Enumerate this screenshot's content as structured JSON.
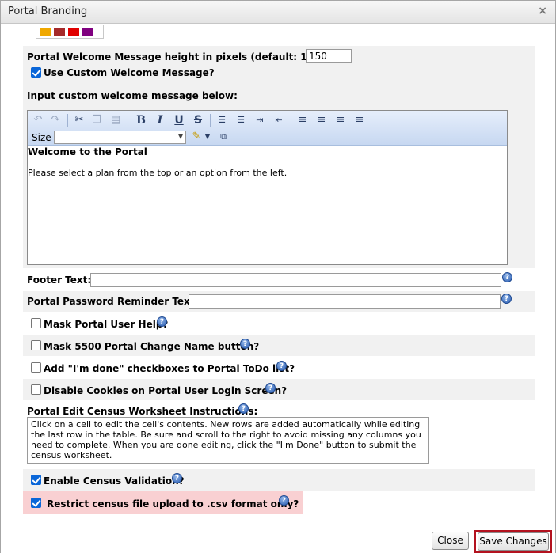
{
  "dialog": {
    "title": "Portal Branding",
    "close_glyph": "×"
  },
  "swatch_colors": [
    "#f0a800",
    "#a52a2a",
    "#e00000",
    "#800080"
  ],
  "welcome_height": {
    "label": "Portal Welcome Message height in pixels (default: 150):",
    "value": "150"
  },
  "use_custom_welcome": {
    "label": "Use Custom Welcome Message?",
    "checked": true
  },
  "custom_welcome_instruction": "Input custom welcome message below:",
  "editor": {
    "size_label": "Size",
    "size_value": "",
    "heading": "Welcome to the Portal",
    "body": "Please select a plan from the top or an option from the left."
  },
  "footer_text": {
    "label": "Footer Text:",
    "value": ""
  },
  "password_reminder": {
    "label": "Portal Password Reminder Text:",
    "value": ""
  },
  "options": [
    {
      "label": "Mask Portal User Help?",
      "checked": false
    },
    {
      "label": "Mask 5500 Portal Change Name button?",
      "checked": false
    },
    {
      "label": "Add \"I'm done\" checkboxes to Portal ToDo list?",
      "checked": false
    },
    {
      "label": "Disable Cookies on Portal User Login Screen?",
      "checked": false
    }
  ],
  "census_instructions": {
    "label": "Portal Edit Census Worksheet Instructions:",
    "text": "Click on a cell to edit the cell's contents.  New rows are added automatically while editing the last row in the table. Be sure and scroll to the right to avoid missing any columns you need to complete. When you are done editing, click the \"I'm Done\" button to submit the census worksheet."
  },
  "enable_census_validation": {
    "label": "Enable Census Validation?",
    "checked": true
  },
  "restrict_csv": {
    "label": "Restrict census file upload to .csv format only?",
    "checked": true
  },
  "help_glyph": "?",
  "buttons": {
    "close": "Close",
    "save": "Save Changes"
  },
  "colors": {
    "checkbox_checked": "#0a66d8",
    "highlight_row": "#f9d0d2",
    "save_outline": "#b3121f"
  }
}
